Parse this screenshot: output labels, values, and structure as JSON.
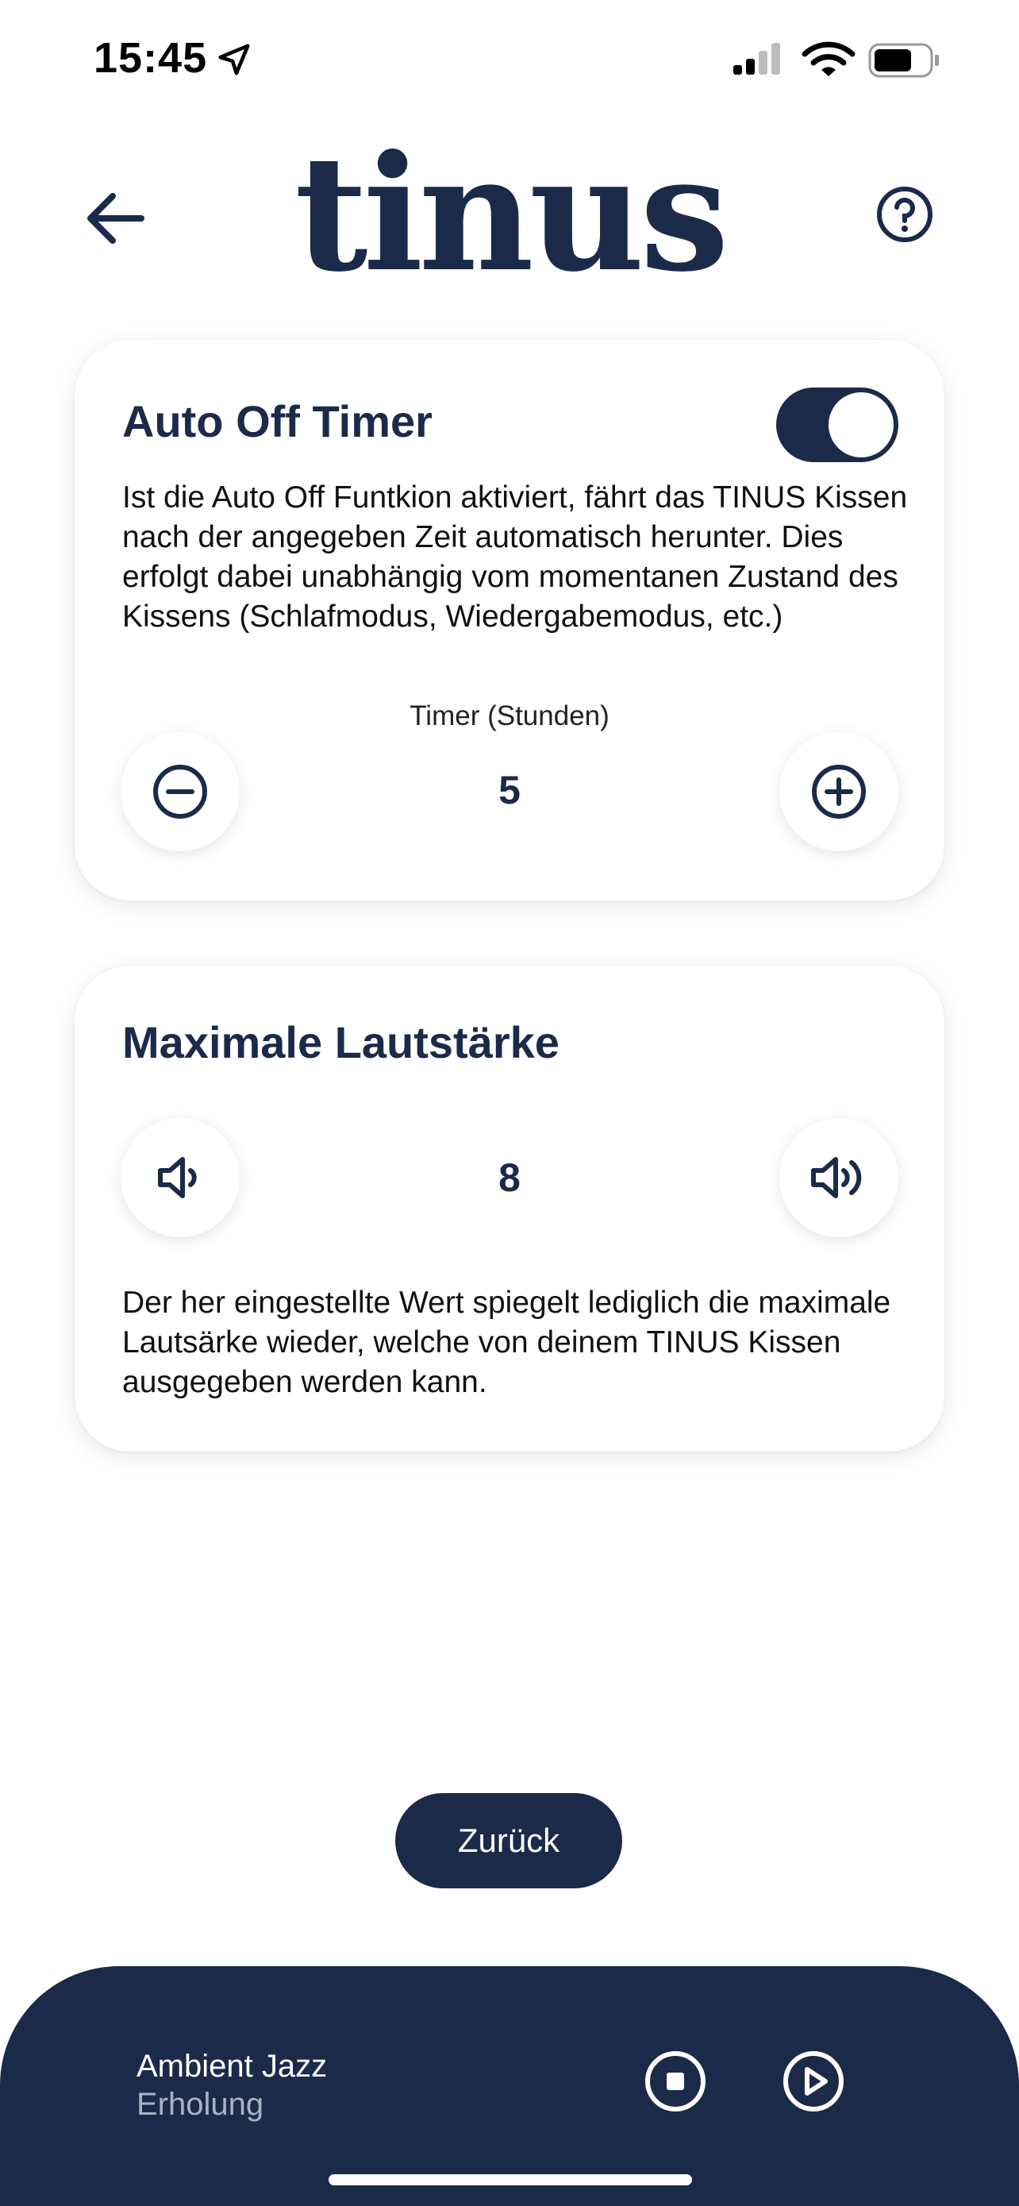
{
  "status_bar": {
    "time": "15:45"
  },
  "header": {
    "logo_text": "tinus",
    "back_icon": "arrow-left-icon",
    "help_icon": "question-circle-icon"
  },
  "auto_off_card": {
    "title": "Auto Off Timer",
    "toggle_on": true,
    "description": "Ist die Auto Off Funtkion aktiviert, fährt das TINUS Kissen nach der angegeben Zeit automatisch herunter. Dies erfolgt dabei unabhängig vom momentanen Zustand des Kissens (Schlafmodus, Wiedergabemodus, etc.)",
    "timer_label": "Timer (Stunden)",
    "timer_value": "5",
    "minus_icon": "minus-circle-icon",
    "plus_icon": "plus-circle-icon"
  },
  "volume_card": {
    "title": "Maximale Lautstärke",
    "value": "8",
    "description": "Der her eingestellte Wert spiegelt lediglich die maximale Lautsärke wieder, welche von deinem TINUS Kissen ausgegeben werden kann.",
    "vol_down_icon": "volume-down-icon",
    "vol_up_icon": "volume-up-icon"
  },
  "back_button": {
    "label": "Zurück"
  },
  "player": {
    "track": "Ambient Jazz",
    "genre": "Erholung",
    "stop_icon": "stop-circle-icon",
    "play_icon": "play-circle-icon"
  },
  "colors": {
    "primary": "#1c2a4a",
    "background": "#ffffff",
    "subtitle": "#a9b2c6"
  }
}
